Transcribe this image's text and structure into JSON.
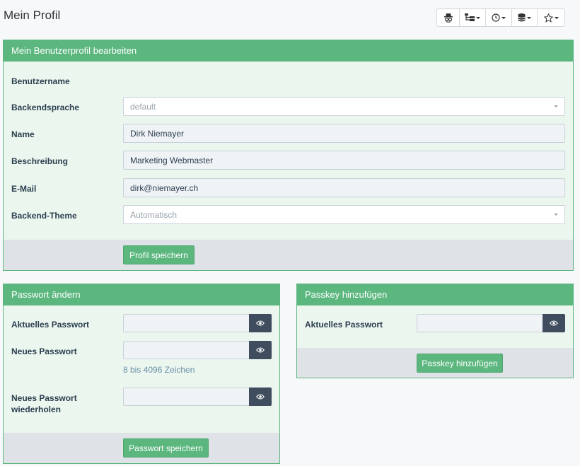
{
  "page": {
    "title": "Mein Profil"
  },
  "toolbar": {
    "icons": [
      "incognito-icon",
      "sitemap-icon",
      "clock-icon",
      "database-icon",
      "star-icon"
    ]
  },
  "profile": {
    "heading": "Mein Benutzerprofil bearbeiten",
    "username_label": "Benutzername",
    "language_label": "Backendsprache",
    "language_value": "default",
    "name_label": "Name",
    "name_value": "Dirk Niemayer",
    "description_label": "Beschreibung",
    "description_value": "Marketing Webmaster",
    "email_label": "E-Mail",
    "email_value": "dirk@niemayer.ch",
    "theme_label": "Backend-Theme",
    "theme_value": "Automatisch",
    "save_label": "Profil speichern"
  },
  "password": {
    "heading": "Passwort ändern",
    "current_label": "Aktuelles Passwort",
    "new_label": "Neues Passwort",
    "hint": "8 bis 4096 Zeichen",
    "repeat_label_line1": "Neues Passwort",
    "repeat_label_line2": "wiederholen",
    "save_label": "Passwort speichern"
  },
  "passkey": {
    "heading": "Passkey hinzufügen",
    "current_label": "Aktuelles Passwort",
    "add_label": "Passkey hinzufügen"
  },
  "colors": {
    "accent": "#5cb77f",
    "panel_bg": "#eaf6ee",
    "footer_bg": "#dfe3e8",
    "eye_button": "#3f4d5e"
  }
}
